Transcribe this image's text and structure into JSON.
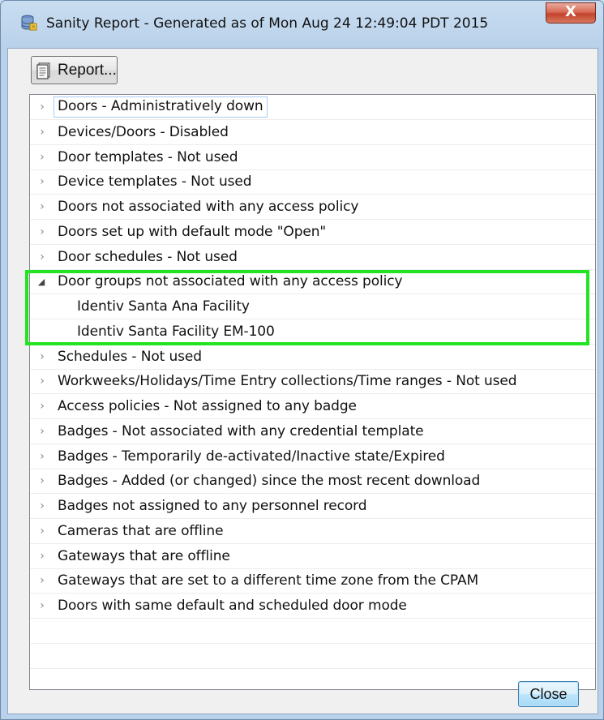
{
  "window": {
    "title": "Sanity Report - Generated as of Mon Aug 24 12:49:04 PDT 2015",
    "close_glyph": "X",
    "icon": "database-icon"
  },
  "toolbar": {
    "report_label": "Report...",
    "report_icon": "report-document-icon"
  },
  "tree": {
    "items": [
      {
        "label": "Doors - Administratively down",
        "expanded": false,
        "selected": true
      },
      {
        "label": "Devices/Doors - Disabled",
        "expanded": false
      },
      {
        "label": "Door templates - Not used",
        "expanded": false
      },
      {
        "label": "Device templates - Not used",
        "expanded": false
      },
      {
        "label": "Doors not associated with any access policy",
        "expanded": false
      },
      {
        "label": "Doors set up with default mode \"Open\"",
        "expanded": false
      },
      {
        "label": "Door schedules - Not used",
        "expanded": false
      },
      {
        "label": "Door groups not associated with any access policy",
        "expanded": true
      },
      {
        "label": "Identiv Santa Ana Facility",
        "child": true
      },
      {
        "label": "Identiv Santa Facility EM-100",
        "child": true
      },
      {
        "label": "Schedules - Not used",
        "expanded": false
      },
      {
        "label": "Workweeks/Holidays/Time Entry collections/Time ranges - Not used",
        "expanded": false
      },
      {
        "label": "Access policies - Not assigned to any badge",
        "expanded": false
      },
      {
        "label": "Badges - Not associated with any credential template",
        "expanded": false
      },
      {
        "label": "Badges - Temporarily de-activated/Inactive state/Expired",
        "expanded": false
      },
      {
        "label": "Badges - Added (or changed) since the most recent download",
        "expanded": false
      },
      {
        "label": "Badges not assigned to any personnel record",
        "expanded": false
      },
      {
        "label": "Cameras that are offline",
        "expanded": false
      },
      {
        "label": "Gateways that are offline",
        "expanded": false
      },
      {
        "label": "Gateways that are set to a different time zone from the CPAM",
        "expanded": false
      },
      {
        "label": "Doors with same default and scheduled door mode",
        "expanded": false
      }
    ],
    "collapsed_glyph": "›",
    "expanded_glyph": "◢"
  },
  "footer": {
    "close_label": "Close"
  },
  "colors": {
    "highlight": "#22e422",
    "title_bar": "#c9ddf1"
  }
}
